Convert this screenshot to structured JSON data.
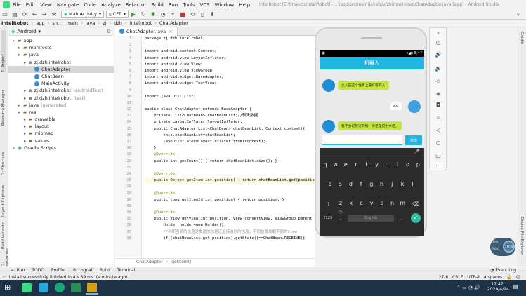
{
  "menu": [
    "File",
    "Edit",
    "View",
    "Navigate",
    "Code",
    "Analyze",
    "Refactor",
    "Build",
    "Run",
    "Tools",
    "VCS",
    "Window",
    "Help"
  ],
  "window_title": "IntelRobot [E:\\Projects\\IntelRobot] - ...\\app\\src\\main\\java\\zj\\dzh\\intelrobot\\ChatAdapter.java [app] - Android Studio",
  "toolbar": {
    "run_config": "MainActivity",
    "device": "CFT"
  },
  "nav": [
    "IntelRobot",
    "app",
    "src",
    "main",
    "java",
    "zj",
    "dzh",
    "intelrobot",
    "ChatAdapter"
  ],
  "project": {
    "header": "Android",
    "items": [
      {
        "label": "app",
        "indent": 0,
        "icon": "folder"
      },
      {
        "label": "manifests",
        "indent": 1,
        "icon": "folder"
      },
      {
        "label": "java",
        "indent": 1,
        "icon": "folder"
      },
      {
        "label": "zj.dzh.intelrobot",
        "indent": 2,
        "icon": "package"
      },
      {
        "label": "ChatAdapter",
        "indent": 3,
        "icon": "class",
        "selected": true
      },
      {
        "label": "ChatBean",
        "indent": 3,
        "icon": "class"
      },
      {
        "label": "MainActivity",
        "indent": 3,
        "icon": "class"
      },
      {
        "label": "zj.dzh.intelrobot",
        "suffix": "(androidTest)",
        "indent": 2,
        "icon": "package"
      },
      {
        "label": "zj.dzh.intelrobot",
        "suffix": "(test)",
        "indent": 2,
        "icon": "package"
      },
      {
        "label": "java",
        "suffix": "(generated)",
        "indent": 1,
        "icon": "folder"
      },
      {
        "label": "res",
        "indent": 1,
        "icon": "folder"
      },
      {
        "label": "drawable",
        "indent": 2,
        "icon": "folder"
      },
      {
        "label": "layout",
        "indent": 2,
        "icon": "folder"
      },
      {
        "label": "mipmap",
        "indent": 2,
        "icon": "folder"
      },
      {
        "label": "values",
        "indent": 2,
        "icon": "folder"
      },
      {
        "label": "Gradle Scripts",
        "indent": 0,
        "icon": "gradle"
      }
    ]
  },
  "editor": {
    "tab": "ChatAdapter.java",
    "breadcrumb": [
      "ChatAdapter",
      "getItem()"
    ],
    "lines": [
      {
        "n": "1",
        "t": "package zj.dzh.intelrobot;"
      },
      {
        "n": "2",
        "t": ""
      },
      {
        "n": "3",
        "t": "import android.content.Context;"
      },
      {
        "n": "4",
        "t": "import android.view.LayoutInflater;"
      },
      {
        "n": "5",
        "t": "import android.view.View;"
      },
      {
        "n": "6",
        "t": "import android.view.ViewGroup;"
      },
      {
        "n": "7",
        "t": "import android.widget.BaseAdapter;"
      },
      {
        "n": "8",
        "t": "import android.widget.TextView;"
      },
      {
        "n": "9",
        "t": ""
      },
      {
        "n": "10",
        "t": "import java.util.List;"
      },
      {
        "n": "11",
        "t": ""
      },
      {
        "n": "12",
        "t": "public class ChatAdapter extends BaseAdapter {"
      },
      {
        "n": "13",
        "t": "    private List<ChatBean> chatBeanList;//聊天数据"
      },
      {
        "n": "14",
        "t": "    private LayoutInflater layoutInflater;"
      },
      {
        "n": "15",
        "t": "    public ChatAdapter(List<ChatBean> chatBeanList, Context context){"
      },
      {
        "n": "16",
        "t": "        this.chatBeanList=chatBeanList;"
      },
      {
        "n": "17",
        "t": "        layoutInflater=LayoutInflater.from(context);"
      },
      {
        "n": "18",
        "t": "    }"
      },
      {
        "n": "19",
        "t": "    @Override"
      },
      {
        "n": "20",
        "t": "    public int getCount() { return chatBeanList.size(); }"
      },
      {
        "n": "23",
        "t": ""
      },
      {
        "n": "24",
        "t": "    @Override"
      },
      {
        "n": "25",
        "t": "    public Object getItem(int position) { return chatBeanList.get(position"
      },
      {
        "n": "28",
        "t": ""
      },
      {
        "n": "29",
        "t": "    @Override"
      },
      {
        "n": "30",
        "t": "    public long getItemId(int position) { return position; }"
      },
      {
        "n": "33",
        "t": ""
      },
      {
        "n": "34",
        "t": "    @Override"
      },
      {
        "n": "35",
        "t": "    public View getView(int position, View convertView, ViewGroup parent"
      },
      {
        "n": "36",
        "t": "        Holder holder=new Holder();"
      },
      {
        "n": "37",
        "t": "        //判断当前的信息是发送的信息还是接收到的信息，不同信息加载不同的view"
      },
      {
        "n": "38",
        "t": "        if (chatBeanList.get(position).getState()==ChatBean.RECEIVE){"
      }
    ]
  },
  "phone": {
    "time": "8:47",
    "title": "机器人",
    "messages": [
      {
        "side": "left",
        "text": "主人是这个世界上最好看的人!"
      },
      {
        "side": "right",
        "text": "abc"
      },
      {
        "side": "left",
        "text": "我不会说英语的哟，你还是说中文吧。"
      }
    ],
    "send_label": "发送",
    "keys_row1": [
      "q",
      "w",
      "e",
      "r",
      "t",
      "y",
      "u",
      "i",
      "o",
      "p"
    ],
    "keys_row2": [
      "a",
      "s",
      "d",
      "f",
      "g",
      "h",
      "j",
      "k",
      "l"
    ],
    "keys_row3": [
      "z",
      "x",
      "c",
      "v",
      "b",
      "n",
      "m"
    ],
    "key_symbols": "?123",
    "key_space": "English"
  },
  "bottom_tabs": [
    "4: Run",
    "TODO",
    "Profiler",
    "6: Logcat",
    "Build",
    "Terminal"
  ],
  "event_log": "Event Log",
  "status_message": "Install successfully finished in 4 s 89 ms. (a minute ago)",
  "status_right": {
    "pos": "27:6",
    "le": "CRLF",
    "enc": "UTF-8",
    "indent": "4 spaces"
  },
  "left_tabs": [
    "1: Project",
    "Resource Manager",
    "2: Structure",
    "Layout Captures",
    "Build Variants",
    "2: Favorites"
  ],
  "right_tabs": [
    "Gradle",
    "Device File Explorer"
  ],
  "overlay": {
    "percent": "76%",
    "up": "0K/s",
    "down": "0K/s"
  },
  "taskbar": {
    "time": "17:47",
    "date": "2020/4/24"
  }
}
